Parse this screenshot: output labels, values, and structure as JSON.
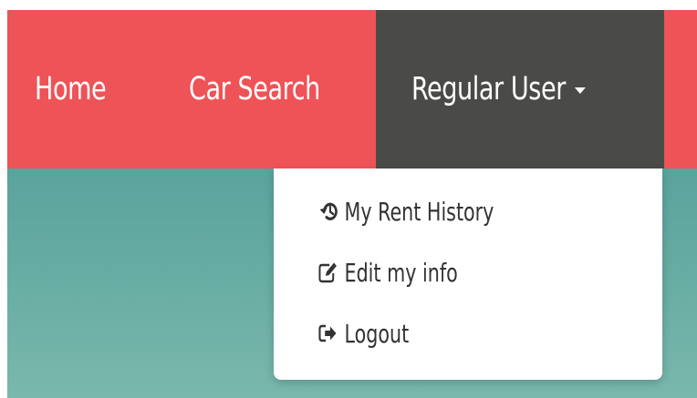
{
  "navbar": {
    "items": [
      {
        "label": "Home"
      },
      {
        "label": "Car Search"
      },
      {
        "label": "Regular User"
      }
    ],
    "colors": {
      "background": "#ee5357",
      "active_background": "#4a4a48",
      "text": "#ffffff"
    }
  },
  "dropdown": {
    "items": [
      {
        "label": "My Rent History",
        "icon": "history-icon"
      },
      {
        "label": "Edit my info",
        "icon": "edit-icon"
      },
      {
        "label": "Logout",
        "icon": "logout-icon"
      }
    ]
  },
  "hero": {
    "color": "#5aa39c"
  }
}
